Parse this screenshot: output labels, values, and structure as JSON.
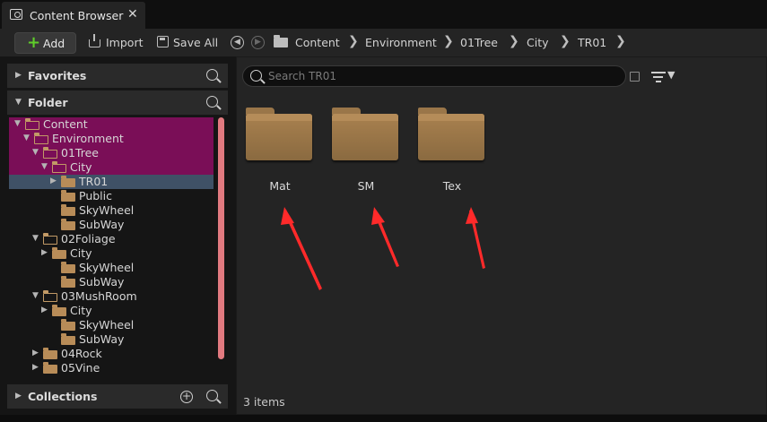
{
  "tab": {
    "title": "Content Browser",
    "close": "✕"
  },
  "toolbar": {
    "add_label": "Add",
    "import_label": "Import",
    "save_all_label": "Save All",
    "breadcrumb": [
      "Content",
      "Environment",
      "01Tree",
      "City",
      "TR01"
    ],
    "separator": "❯"
  },
  "sidebar": {
    "favorites_label": "Favorites",
    "folder_label": "Folder",
    "collections_label": "Collections",
    "tree": [
      {
        "label": "Content",
        "depth": 0,
        "expanded": true,
        "state": "path"
      },
      {
        "label": "Environment",
        "depth": 1,
        "expanded": true,
        "state": "path"
      },
      {
        "label": "01Tree",
        "depth": 2,
        "expanded": true,
        "state": "path"
      },
      {
        "label": "City",
        "depth": 3,
        "expanded": true,
        "state": "path"
      },
      {
        "label": "TR01",
        "depth": 4,
        "expanded": false,
        "state": "selected"
      },
      {
        "label": "Public",
        "depth": 4,
        "expanded": null,
        "state": ""
      },
      {
        "label": "SkyWheel",
        "depth": 4,
        "expanded": null,
        "state": ""
      },
      {
        "label": "SubWay",
        "depth": 4,
        "expanded": null,
        "state": ""
      },
      {
        "label": "02Foliage",
        "depth": 2,
        "expanded": true,
        "state": ""
      },
      {
        "label": "City",
        "depth": 3,
        "expanded": false,
        "state": ""
      },
      {
        "label": "SkyWheel",
        "depth": 4,
        "expanded": null,
        "state": ""
      },
      {
        "label": "SubWay",
        "depth": 4,
        "expanded": null,
        "state": ""
      },
      {
        "label": "03MushRoom",
        "depth": 2,
        "expanded": true,
        "state": ""
      },
      {
        "label": "City",
        "depth": 3,
        "expanded": false,
        "state": ""
      },
      {
        "label": "SkyWheel",
        "depth": 4,
        "expanded": null,
        "state": ""
      },
      {
        "label": "SubWay",
        "depth": 4,
        "expanded": null,
        "state": ""
      },
      {
        "label": "04Rock",
        "depth": 2,
        "expanded": false,
        "state": ""
      },
      {
        "label": "05Vine",
        "depth": 2,
        "expanded": false,
        "state": ""
      }
    ]
  },
  "content": {
    "search_placeholder": "Search TR01",
    "folders": [
      "Mat",
      "SM",
      "Tex"
    ],
    "items_count": "3 items"
  },
  "colors": {
    "selection_path": "#7a0e57",
    "selected": "#3f5166",
    "folder": "#b88c58",
    "add_plus": "#5fcf2a",
    "annotation_arrow": "#ff2a2a"
  }
}
